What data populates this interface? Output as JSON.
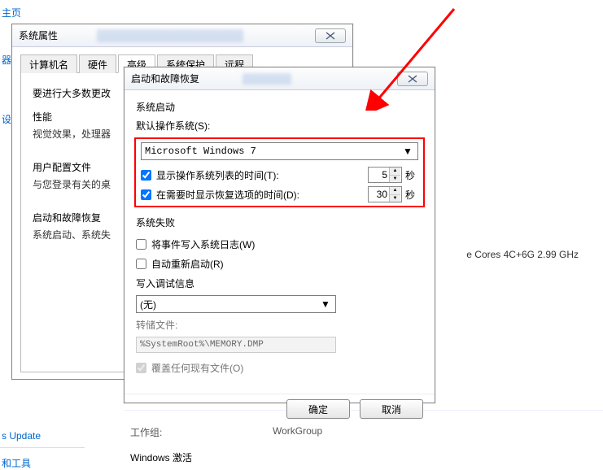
{
  "sidebar": {
    "home": "主页",
    "mgr": "器",
    "settings": "设置",
    "update": "s Update",
    "tools": "和工具"
  },
  "background": {
    "cpu": "e Cores 4C+6G     2.99 GHz",
    "workgroup_label": "工作组:",
    "workgroup_value": "WorkGroup",
    "activate": "Windows 激活"
  },
  "parent_dialog": {
    "title": "系统属性",
    "tabs": [
      "计算机名",
      "硬件",
      "高级",
      "系统保护",
      "远程"
    ],
    "active_tab": 2,
    "note": "要进行大多数更改",
    "perf_hdr": "性能",
    "perf_sub": "视觉效果，处理器",
    "profile_hdr": "用户配置文件",
    "profile_sub": "与您登录有关的桌",
    "startup_hdr": "启动和故障恢复",
    "startup_sub": "系统启动、系统失"
  },
  "child_dialog": {
    "title": "启动和故障恢复",
    "startup": {
      "group": "系统启动",
      "default_os_label": "默认操作系统(S):",
      "default_os_value": "Microsoft Windows 7",
      "show_os_list_label": "显示操作系统列表的时间(T):",
      "show_os_list_checked": true,
      "show_os_list_value": "5",
      "show_recovery_label": "在需要时显示恢复选项的时间(D):",
      "show_recovery_checked": true,
      "show_recovery_value": "30",
      "unit": "秒"
    },
    "failure": {
      "group": "系统失败",
      "write_event_label": "将事件写入系统日志(W)",
      "write_event_checked": false,
      "auto_restart_label": "自动重新启动(R)",
      "auto_restart_checked": false,
      "debug_info_label": "写入调试信息",
      "debug_info_value": "(无)",
      "dump_file_label": "转储文件:",
      "dump_file_value": "%SystemRoot%\\MEMORY.DMP",
      "overwrite_label": "覆盖任何现有文件(O)",
      "overwrite_checked": true
    },
    "buttons": {
      "ok": "确定",
      "cancel": "取消"
    }
  }
}
